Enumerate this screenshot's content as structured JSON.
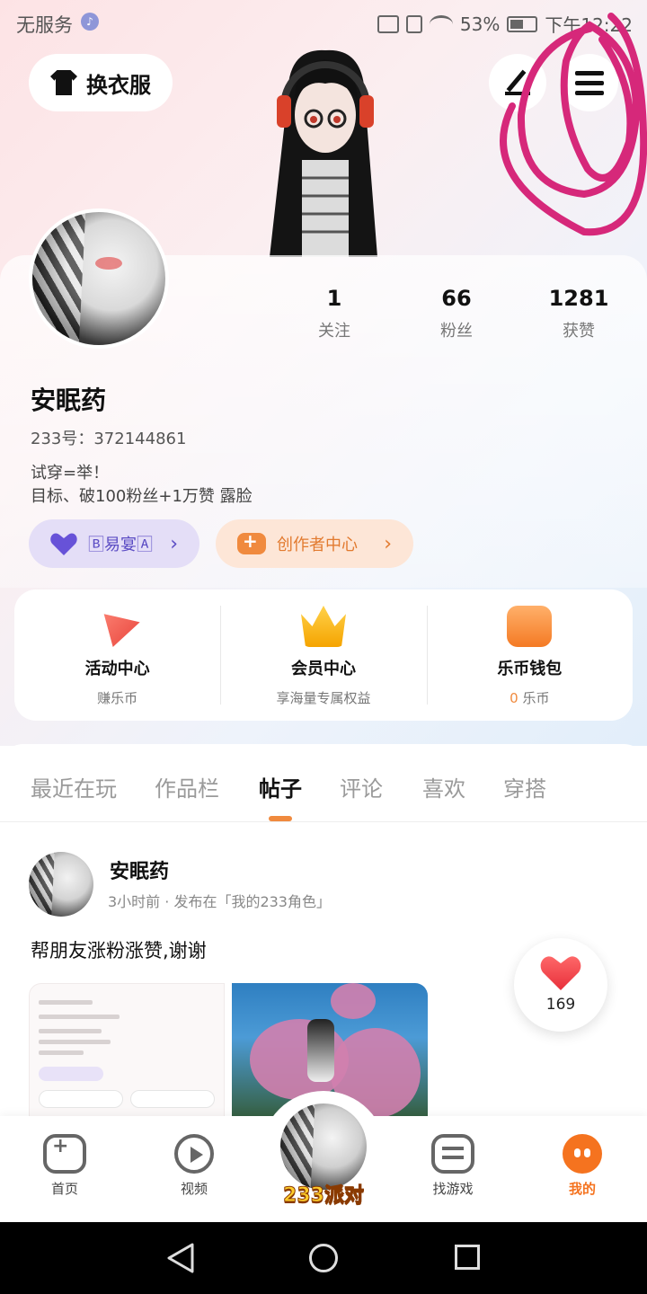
{
  "status_bar": {
    "carrier": "无服务",
    "battery": "53%",
    "time": "下午12:22"
  },
  "header": {
    "outfit_button_label": "换衣服"
  },
  "profile": {
    "name": "安眠药",
    "id_line": "233号：372144861",
    "bio_line1": "试穿=举！",
    "bio_line2": "目标、破100粉丝+1万赞 露脸",
    "stats": [
      {
        "value": "1",
        "label": "关注"
      },
      {
        "value": "66",
        "label": "粉丝"
      },
      {
        "value": "1281",
        "label": "获赞"
      }
    ],
    "exchange_pill_label": "🄱易宴🄰",
    "creator_pill_label": "创作者中心"
  },
  "services": [
    {
      "title": "活动中心",
      "subtitle": "赚乐币"
    },
    {
      "title": "会员中心",
      "subtitle": "享海量专属权益"
    },
    {
      "title": "乐币钱包",
      "subtitle_value": "0",
      "subtitle_unit": "乐币"
    }
  ],
  "tabs": [
    "最近在玩",
    "作品栏",
    "帖子",
    "评论",
    "喜欢",
    "穿搭"
  ],
  "active_tab": "帖子",
  "post": {
    "author": "安眠药",
    "meta": "3小时前 · 发布在「我的233角色」",
    "text": "帮朋友涨粉涨赞,谢谢",
    "likes": "169"
  },
  "bottom_nav": {
    "items": [
      "首页",
      "视频",
      "找游戏",
      "我的"
    ],
    "center_label": "233派对",
    "active": "我的"
  },
  "colors": {
    "accent": "#f5731f",
    "creator": "#e27a2f",
    "exchange": "#5b4cc4",
    "scribble": "#d6287a"
  }
}
